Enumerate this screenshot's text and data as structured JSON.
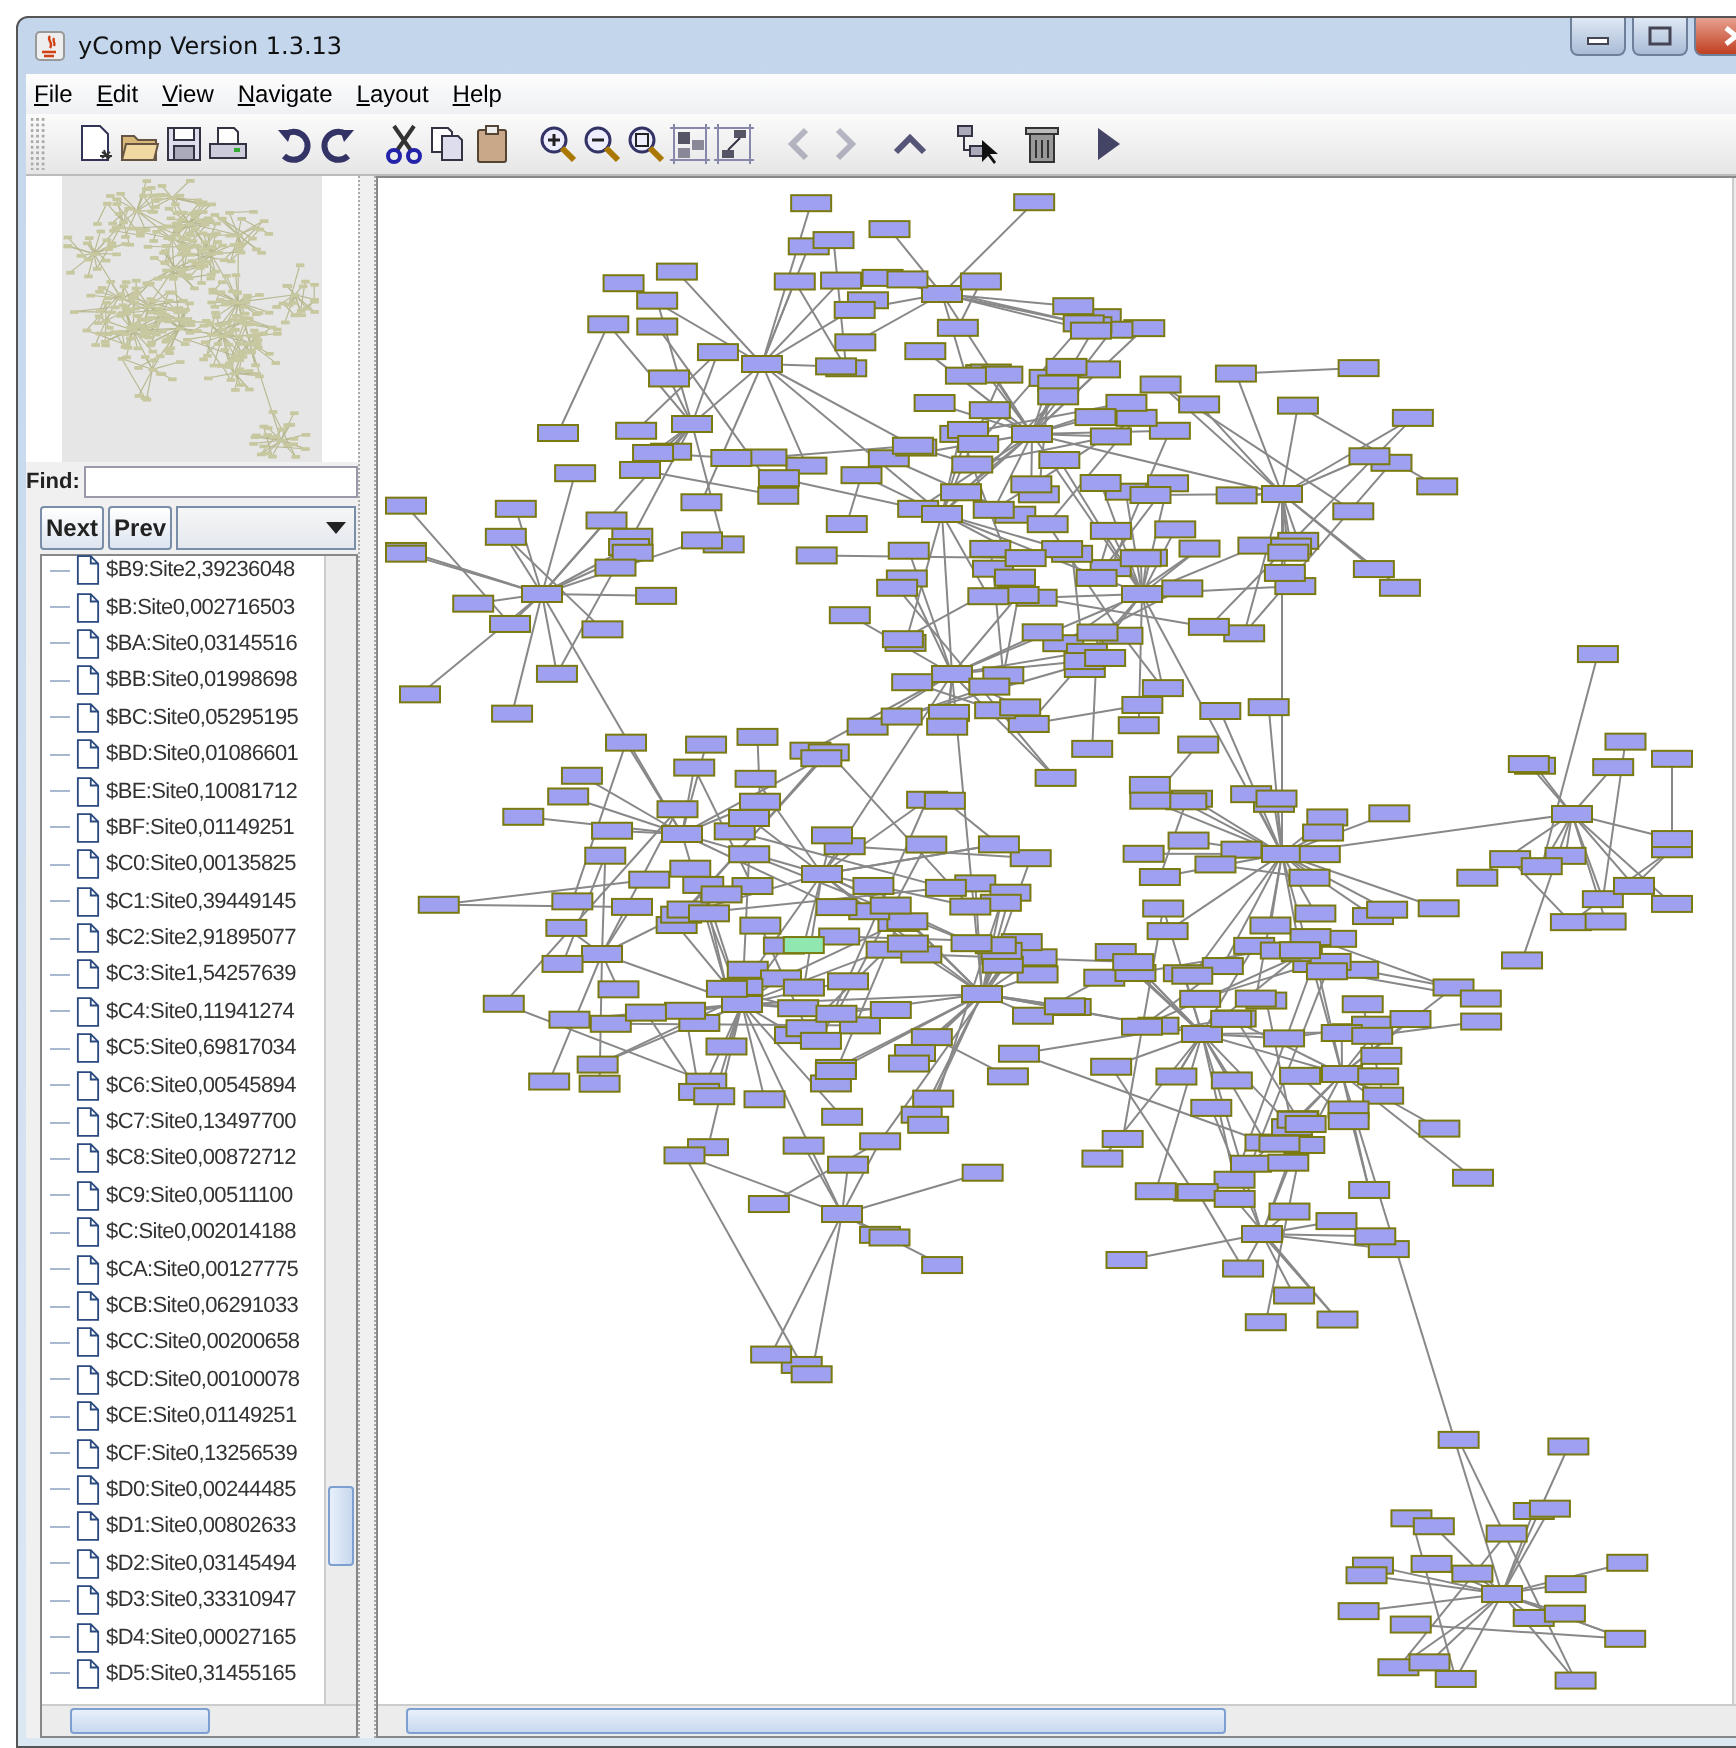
{
  "window": {
    "title": "yComp Version 1.3.13"
  },
  "menu": [
    "File",
    "Edit",
    "View",
    "Navigate",
    "Layout",
    "Help"
  ],
  "toolbar": [
    {
      "kind": "new",
      "disabled": false
    },
    {
      "kind": "open",
      "disabled": false
    },
    {
      "kind": "save",
      "disabled": false
    },
    {
      "kind": "print",
      "disabled": false
    },
    {
      "kind": "undo",
      "disabled": false
    },
    {
      "kind": "redo",
      "disabled": false
    },
    {
      "kind": "cut",
      "disabled": false
    },
    {
      "kind": "copy",
      "disabled": false
    },
    {
      "kind": "paste",
      "disabled": false
    },
    {
      "kind": "zoom-in",
      "disabled": false
    },
    {
      "kind": "zoom-out",
      "disabled": false
    },
    {
      "kind": "zoom-fit",
      "disabled": false
    },
    {
      "kind": "layout",
      "disabled": false
    },
    {
      "kind": "layout-tree",
      "disabled": false
    },
    {
      "kind": "back",
      "disabled": true
    },
    {
      "kind": "forward",
      "disabled": true
    },
    {
      "kind": "up",
      "disabled": false
    },
    {
      "kind": "select",
      "disabled": false
    },
    {
      "kind": "delete",
      "disabled": false
    },
    {
      "kind": "play",
      "disabled": false
    }
  ],
  "find": {
    "label": "Find:"
  },
  "buttons": [
    "Next",
    "Prev"
  ],
  "tree": {
    "items": [
      "$B9:Site2,39236048",
      "$B:Site0,002716503",
      "$BA:Site0,03145516",
      "$BB:Site0,01998698",
      "$BC:Site0,05295195",
      "$BD:Site0,01086601",
      "$BE:Site0,10081712",
      "$BF:Site0,01149251",
      "$C0:Site0,00135825",
      "$C1:Site0,39449145",
      "$C2:Site2,91895077",
      "$C3:Site1,54257639",
      "$C4:Site0,11941274",
      "$C5:Site0,69817034",
      "$C6:Site0,00545894",
      "$C7:Site0,13497700",
      "$C8:Site0,00872712",
      "$C9:Site0,00511100",
      "$C:Site0,002014188",
      "$CA:Site0,00127775",
      "$CB:Site0,06291033",
      "$CC:Site0,00200658",
      "$CD:Site0,00100078",
      "$CE:Site0,01149251",
      "$CF:Site0,13256539",
      "$D0:Site0,00244485",
      "$D1:Site0,00802633",
      "$D2:Site0,03145494",
      "$D3:Site0,33310947",
      "$D4:Site0,00027165",
      "$D5:Site0,31455165"
    ]
  }
}
